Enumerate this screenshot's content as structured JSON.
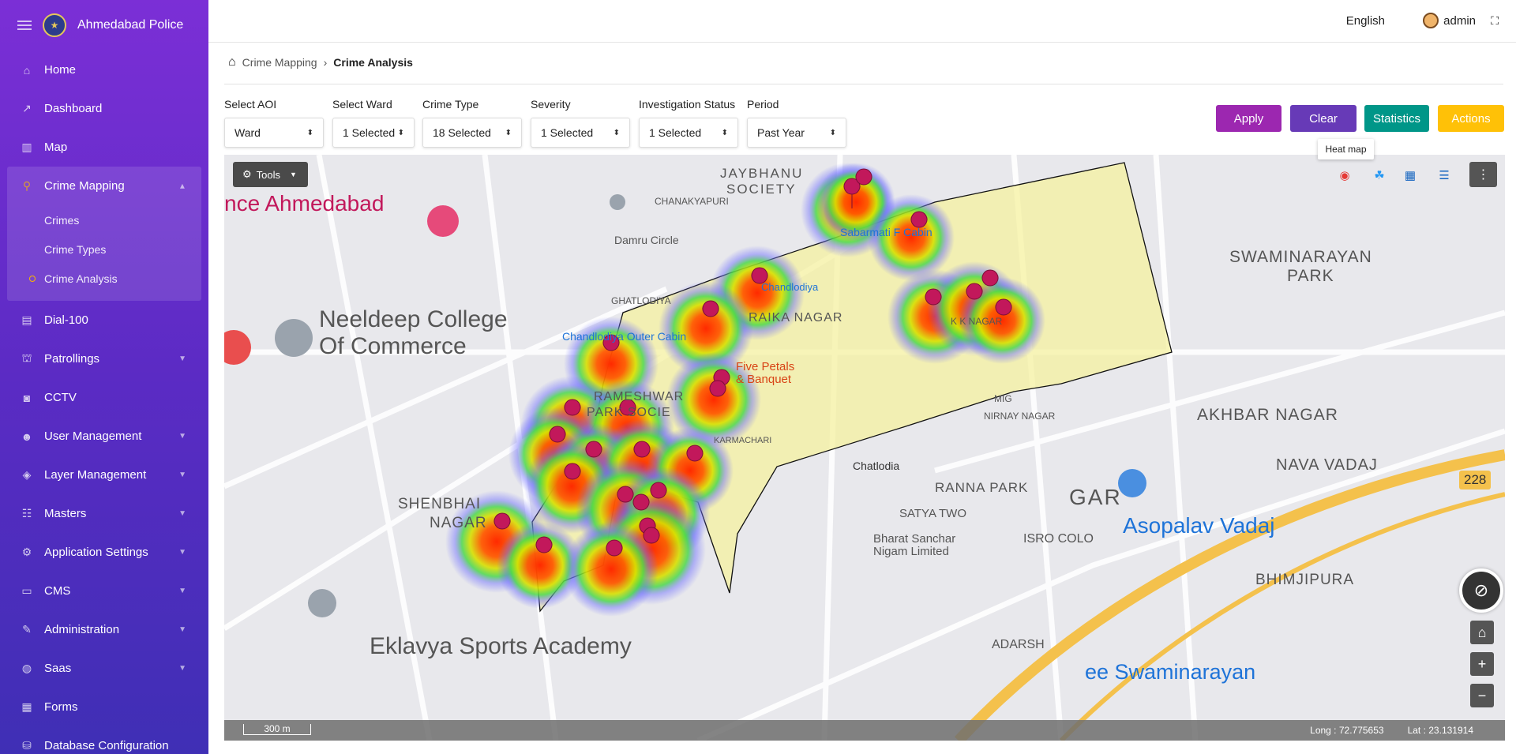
{
  "app": {
    "title": "Ahmedabad Police"
  },
  "topbar": {
    "language": "English",
    "user": "admin"
  },
  "sidebar": {
    "items": [
      {
        "label": "Home",
        "icon": "home-icon"
      },
      {
        "label": "Dashboard",
        "icon": "chart-line-icon"
      },
      {
        "label": "Map",
        "icon": "map-icon"
      },
      {
        "label": "Crime Mapping",
        "icon": "crime-mapping-icon",
        "expanded": true,
        "children": [
          "Crimes",
          "Crime Types",
          "Crime Analysis"
        ],
        "active_child": "Crime Analysis"
      },
      {
        "label": "Dial-100",
        "icon": "file-icon"
      },
      {
        "label": "Patrollings",
        "icon": "patrol-icon"
      },
      {
        "label": "CCTV",
        "icon": "camera-icon"
      },
      {
        "label": "User Management",
        "icon": "users-icon"
      },
      {
        "label": "Layer Management",
        "icon": "layers-icon"
      },
      {
        "label": "Masters",
        "icon": "masters-icon"
      },
      {
        "label": "Application Settings",
        "icon": "gears-icon"
      },
      {
        "label": "CMS",
        "icon": "cms-icon"
      },
      {
        "label": "Administration",
        "icon": "wrench-icon"
      },
      {
        "label": "Saas",
        "icon": "globe-icon"
      },
      {
        "label": "Forms",
        "icon": "forms-icon"
      },
      {
        "label": "Database Configuration",
        "icon": "database-icon"
      }
    ]
  },
  "breadcrumb": {
    "parent": "Crime Mapping",
    "current": "Crime Analysis"
  },
  "filters": [
    {
      "label": "Select AOI",
      "value": "Ward"
    },
    {
      "label": "Select Ward",
      "value": "1 Selected"
    },
    {
      "label": "Crime Type",
      "value": "18 Selected"
    },
    {
      "label": "Severity",
      "value": "1 Selected"
    },
    {
      "label": "Investigation Status",
      "value": "1 Selected"
    },
    {
      "label": "Period",
      "value": "Past Year"
    }
  ],
  "actions": {
    "apply": "Apply",
    "clear": "Clear",
    "statistics": "Statistics",
    "actions": "Actions",
    "colors": {
      "apply": "#9c27b0",
      "clear": "#673ab7",
      "statistics": "#009688",
      "actions": "#ffc107"
    }
  },
  "tooltip": "Heat map",
  "map": {
    "tools_label": "Tools",
    "scale": "300 m",
    "long": "Long : 72.775653",
    "lat": "Lat : 23.131914",
    "labels": {
      "ahmedabad": "nce Ahmedabad",
      "neeldeep": "Neeldeep College",
      "commerce": "Of Commerce",
      "jaybhanu": "JAYBHANU",
      "society": "SOCIETY",
      "chanakya": "CHANAKYAPURI",
      "damru": "Damru Circle",
      "ghatlodiya": "GHATLODIYA",
      "sabarmati": "Sabarmati F Cabin",
      "chandlodiya": "Chandlodiya",
      "chandlodiya_outer": "Chandlodiya Outer Cabin",
      "raika": "RAIKA NAGAR",
      "rameshwar": "RAMESHWAR",
      "parksoc": "PARK SOCIE",
      "five_petals": "Five Petals",
      "banquet": "& Banquet",
      "kk_nagar": "K K NAGAR",
      "mig": "MIG",
      "nirnay": "NIRNAY NAGAR",
      "chatlodia": "Chatlodia",
      "swaminarayan": "SWAMINARAYAN",
      "park": "PARK",
      "akhbar": "AKHBAR NAGAR",
      "nava_vadaj": "NAVA VADAJ",
      "shenbhai": "SHENBHAI",
      "nagar": "NAGAR",
      "ranna": "RANNA PARK",
      "satya": "SATYA TWO",
      "bsnl": "Bharat Sanchar",
      "nigam": "Nigam Limited",
      "isro": "ISRO COLO",
      "asopalav": "Asopalav Vadaj",
      "bhimjipura": "BHIMJIPURA",
      "eklavya": "Eklavya Sports Academy",
      "adarsh": "ADARSH",
      "ee_swami": "ee Swaminarayan",
      "karmachari": "KARMACHARI",
      "road_228": "228",
      "gar": "GAR"
    }
  }
}
